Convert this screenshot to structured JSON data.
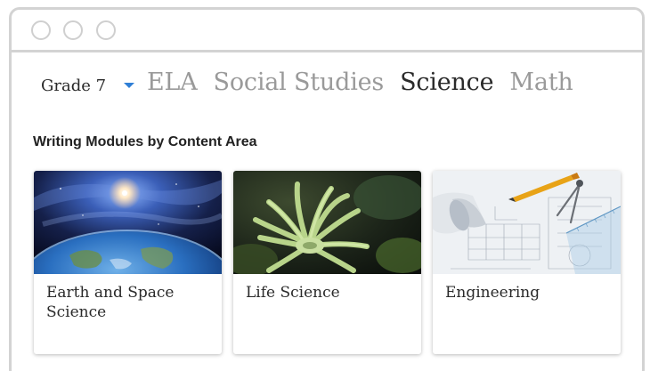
{
  "grade": {
    "selected": "Grade 7"
  },
  "subject_tabs": [
    {
      "label": "ELA",
      "active": false
    },
    {
      "label": "Social Studies",
      "active": false
    },
    {
      "label": "Science",
      "active": true
    },
    {
      "label": "Math",
      "active": false
    }
  ],
  "section": {
    "title": "Writing Modules by Content Area"
  },
  "cards": [
    {
      "title": "Earth and Space Science",
      "image": "earth-from-space"
    },
    {
      "title": "Life Science",
      "image": "sea-anemone"
    },
    {
      "title": "Engineering",
      "image": "blueprint-drafting-tools"
    }
  ],
  "colors": {
    "accent": "#2f7fd6",
    "active_tab": "#2b2b2b",
    "inactive_tab": "#9a9a9a"
  }
}
